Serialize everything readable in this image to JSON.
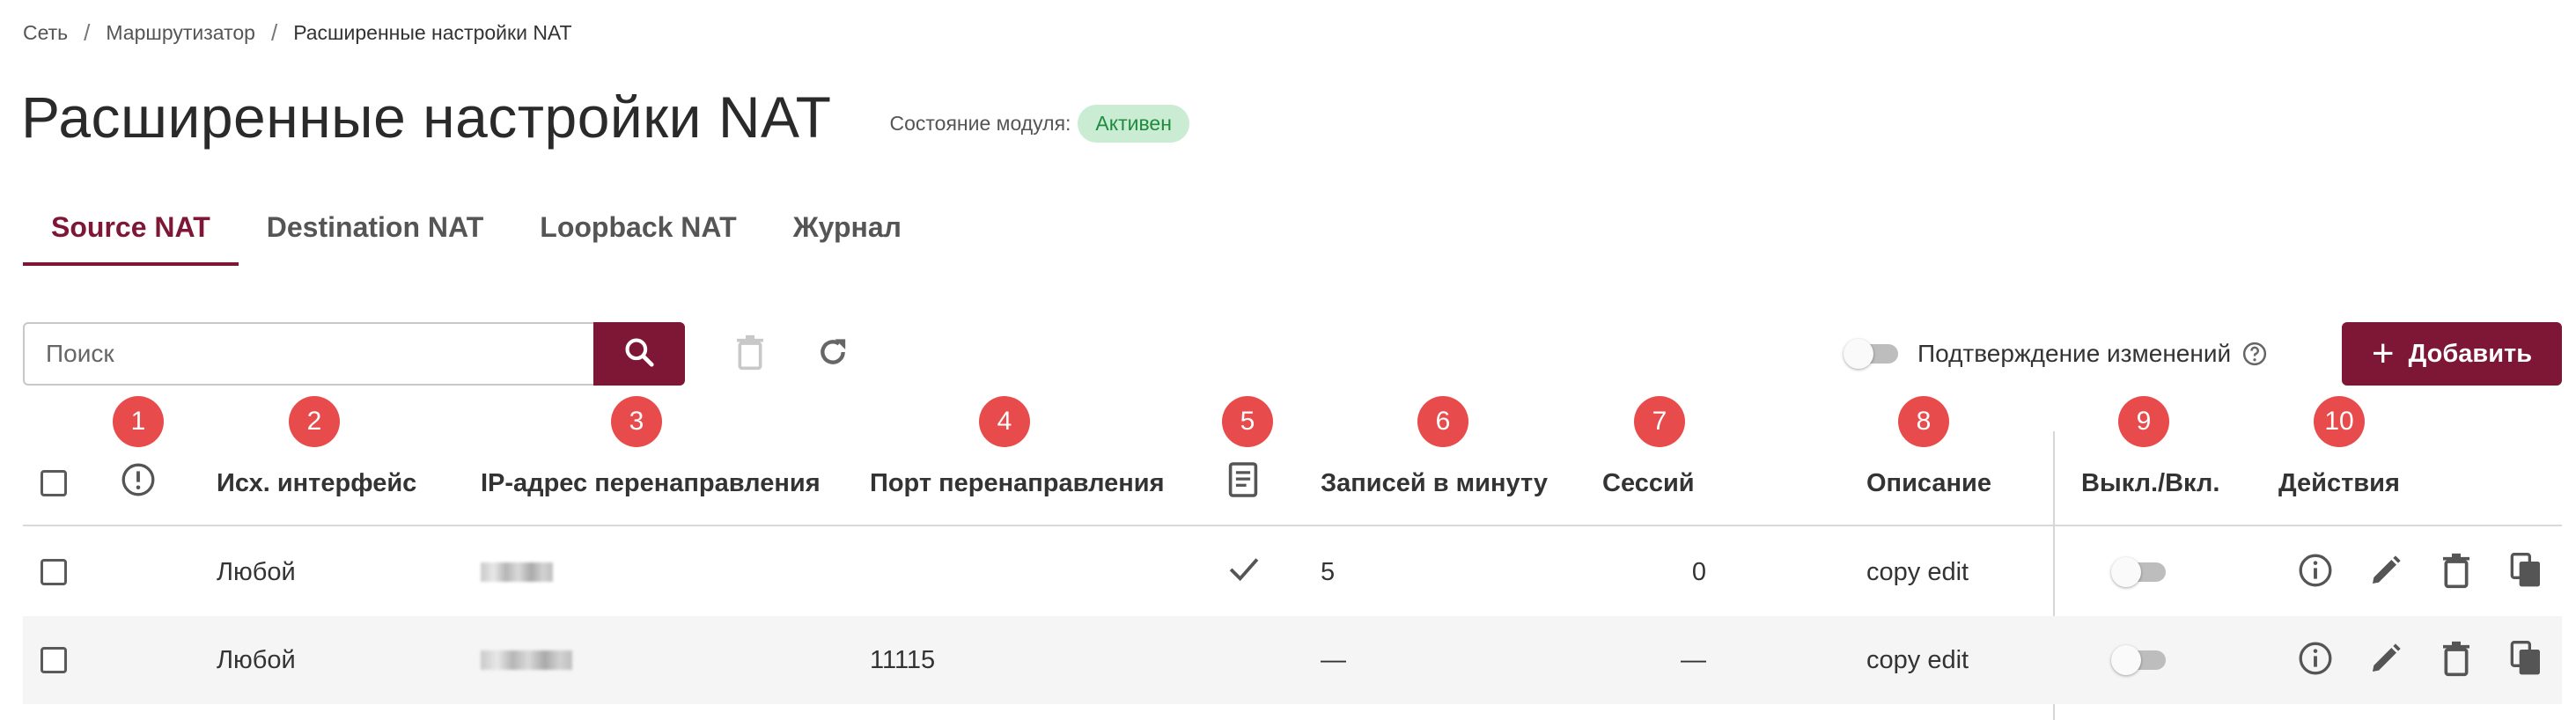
{
  "breadcrumb": [
    "Сеть",
    "Маршрутизатор",
    "Расширенные настройки NAT"
  ],
  "page": {
    "title": "Расширенные настройки NAT",
    "module_state_label": "Состояние модуля:",
    "module_state_value": "Активен"
  },
  "tabs": [
    {
      "label": "Source NAT",
      "active": true
    },
    {
      "label": "Destination NAT",
      "active": false
    },
    {
      "label": "Loopback NAT",
      "active": false
    },
    {
      "label": "Журнал",
      "active": false
    }
  ],
  "toolbar": {
    "search_placeholder": "Поиск",
    "search_value": "",
    "confirm_changes_label": "Подтверждение изменений",
    "confirm_changes_enabled": false,
    "add_label": "Добавить"
  },
  "markers": [
    "1",
    "2",
    "3",
    "4",
    "5",
    "6",
    "7",
    "8",
    "9",
    "10"
  ],
  "table": {
    "columns": {
      "source_interface": "Исх. интерфейс",
      "redirect_ip": "IP-адрес перенаправления",
      "redirect_port": "Порт перенаправления",
      "records_per_minute": "Записей в минуту",
      "sessions": "Сессий",
      "description": "Описание",
      "toggle": "Выкл./Вкл.",
      "actions": "Действия"
    },
    "rows": [
      {
        "source_interface": "Любой",
        "redirect_ip": "",
        "redirect_port": "",
        "log": true,
        "records_per_minute": "5",
        "sessions": "0",
        "description": "copy edit",
        "enabled": false
      },
      {
        "source_interface": "Любой",
        "redirect_ip": "",
        "redirect_port": "11115",
        "log": false,
        "records_per_minute": "—",
        "sessions": "—",
        "description": "copy edit",
        "enabled": false
      }
    ]
  },
  "colors": {
    "accent": "#7d1735",
    "badge_bg": "#c9ecd3",
    "badge_text": "#1e8b3e",
    "marker": "#e84b4b",
    "alt_row": "#f5f5f5"
  },
  "icons": [
    "search-icon",
    "trash-icon",
    "refresh-icon",
    "help-icon",
    "plus-icon",
    "alert-circle-icon",
    "log-document-icon",
    "checkmark-icon",
    "info-icon",
    "edit-icon",
    "delete-icon",
    "copy-icon"
  ]
}
